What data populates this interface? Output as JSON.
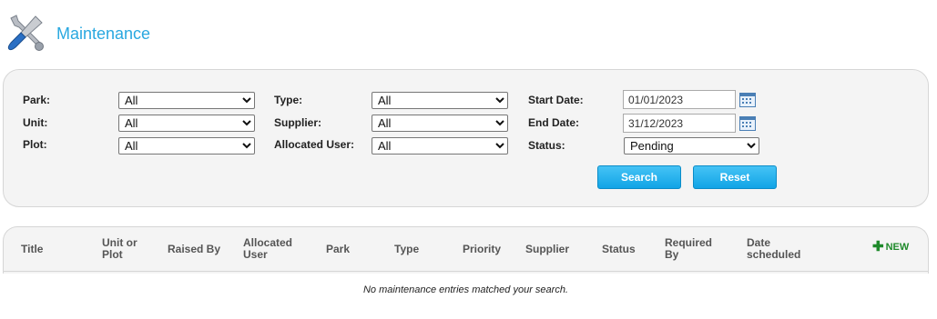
{
  "header": {
    "title": "Maintenance",
    "icon": "tools-icon"
  },
  "filters": {
    "park_label": "Park:",
    "park_value": "All",
    "unit_label": "Unit:",
    "unit_value": "All",
    "plot_label": "Plot:",
    "plot_value": "All",
    "type_label": "Type:",
    "type_value": "All",
    "supplier_label": "Supplier:",
    "supplier_value": "All",
    "allocated_user_label": "Allocated User:",
    "allocated_user_value": "All",
    "start_date_label": "Start Date:",
    "start_date_value": "01/01/2023",
    "end_date_label": "End Date:",
    "end_date_value": "31/12/2023",
    "status_label": "Status:",
    "status_value": "Pending",
    "search_label": "Search",
    "reset_label": "Reset"
  },
  "table": {
    "columns": [
      "Title",
      "Unit or Plot",
      "Raised By",
      "Allocated User",
      "Park",
      "Type",
      "Priority",
      "Supplier",
      "Status",
      "Required By",
      "Date scheduled"
    ],
    "new_label": "NEW",
    "empty_message": "No maintenance entries matched your search."
  },
  "colors": {
    "accent": "#29a8e0",
    "button": "#1aa9ea",
    "new": "#1f8a2b",
    "panel": "#f4f4f4"
  }
}
